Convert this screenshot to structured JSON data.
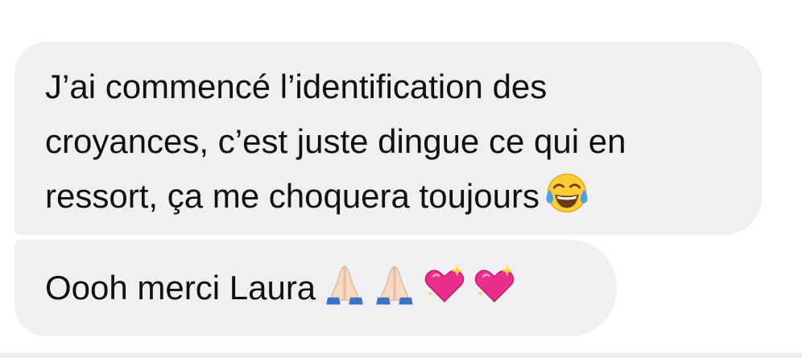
{
  "messages": [
    {
      "lines": [
        "J’ai commencé l’identification des",
        "croyances, c’est juste dingue ce qui en",
        "ressort, ça me choquera toujours"
      ],
      "emojis": [
        "face-with-tears-of-joy-icon"
      ]
    },
    {
      "lines": [
        "Oooh merci Laura"
      ],
      "emojis": [
        "folded-hands-icon",
        "folded-hands-icon",
        "sparkling-heart-icon",
        "sparkling-heart-icon"
      ]
    }
  ],
  "colors": {
    "bubble_background": "#f0f0f2",
    "text": "#111111",
    "page_background": "#ffffff"
  }
}
